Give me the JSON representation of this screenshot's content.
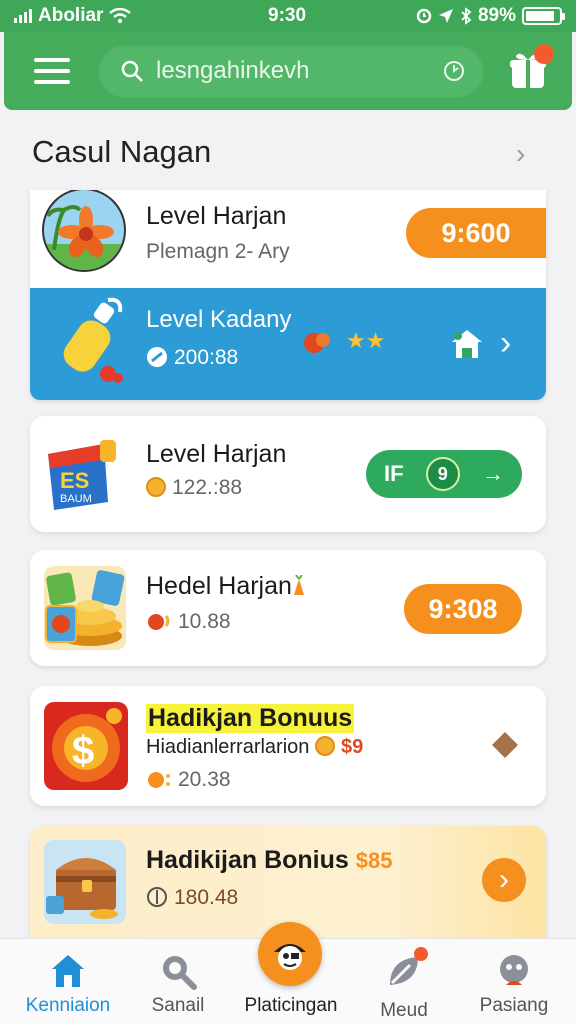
{
  "status_bar": {
    "carrier": "Aboliar",
    "time": "9:30",
    "battery": "89%",
    "battery_level": 0.89
  },
  "app_bar": {
    "search_placeholder": "lesngahinkevh"
  },
  "section": {
    "title": "Casul Nagan",
    "arrow": "›"
  },
  "cards": [
    {
      "title": "Level Harjan",
      "subtitle": "Plemagn 2- Ary",
      "action_label": "9:600",
      "action_color": "#f5901e",
      "thumb_icon": "flower-icon",
      "sub_row": {
        "title": "Level Kadany",
        "value": "200:88",
        "stars": "★★",
        "background": "#2d9bd6",
        "thumb_icon": "bottle-icon"
      }
    },
    {
      "title": "Level Harjan",
      "value": "122.:88",
      "action_label": "IF",
      "action_badge": "9",
      "action_arrow": "→",
      "action_color": "#2eaa5f",
      "thumb_icon": "box-icon",
      "box_text_top": "ES",
      "box_text_bottom": "BAUM"
    },
    {
      "title": "Hedel Harjan",
      "value": "10.88",
      "action_label": "9:308",
      "action_color": "#f5901e",
      "thumb_icon": "coins-icon"
    },
    {
      "title": "Hadikjan Bonuus",
      "subtitle": "Hiadianlerrarlarion",
      "subtitle_badge": "$9",
      "value": "20.38",
      "thumb_icon": "dollar-icon"
    },
    {
      "title": "Hadikijan Bonius",
      "title_badge": "$85",
      "value": "180.48",
      "thumb_icon": "chest-icon",
      "action_color": "#f5901e"
    }
  ],
  "bottom_nav": [
    {
      "label": "Kenniaion",
      "icon": "home-icon",
      "active": true
    },
    {
      "label": "Sanail",
      "icon": "search-icon"
    },
    {
      "label": "Platicingan",
      "icon": "pirate-icon"
    },
    {
      "label": "Meud",
      "icon": "leaf-icon"
    },
    {
      "label": "Pasiang",
      "icon": "profile-icon"
    }
  ],
  "colors": {
    "green_header": "#45ad5c",
    "blue_row": "#2d9bd6",
    "orange": "#f5901e",
    "green_action": "#2eaa5f",
    "highlight_yellow": "#f7f33a"
  }
}
